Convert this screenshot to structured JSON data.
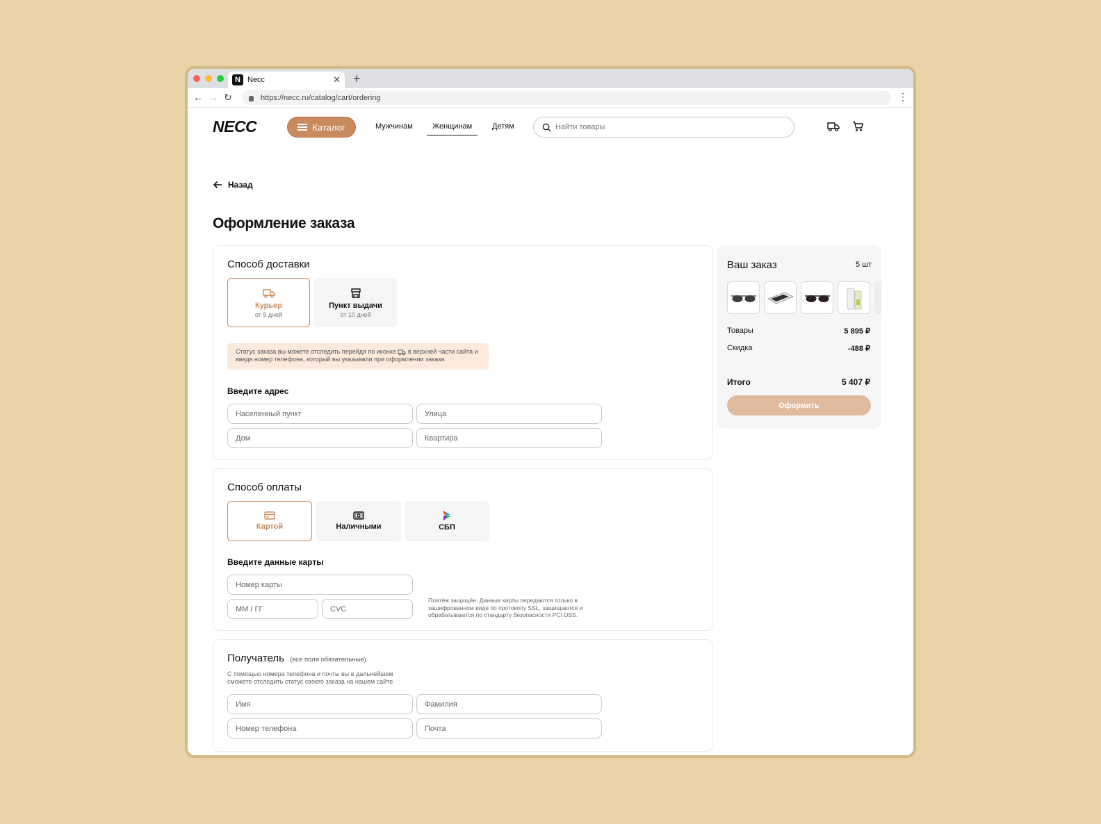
{
  "browser": {
    "tab_title": "Necc",
    "tab_favicon": "N",
    "url": "https://necc.ru/catalog/cart/ordering"
  },
  "header": {
    "logo": "NECC",
    "catalog": "Каталог",
    "nav": [
      "Мужчинам",
      "Женщинам",
      "Детям"
    ],
    "search_placeholder": "Найти товары"
  },
  "page": {
    "back": "Назад",
    "title": "Оформление заказа"
  },
  "delivery": {
    "title": "Способ доставки",
    "options": [
      {
        "label": "Курьер",
        "sub": "от 5 дней",
        "icon": "truck-icon"
      },
      {
        "label": "Пункт выдачи",
        "sub": "от 10 дней",
        "icon": "store-icon"
      }
    ],
    "notice_before": "Статус заказа вы можете отследить перейдя по иконке",
    "notice_after": "в верхней части сайта и введя номер телефона, который вы указывали при оформлении заказа",
    "address_label": "Введите адрес",
    "fields": [
      "Населенный пункт",
      "Улица",
      "Дом",
      "Квартира"
    ]
  },
  "payment": {
    "title": "Способ оплаты",
    "options": [
      {
        "label": "Картой",
        "icon": "card-icon"
      },
      {
        "label": "Наличными",
        "icon": "cash-icon"
      },
      {
        "label": "СБП",
        "icon": "sbp-icon"
      }
    ],
    "card_label": "Введите данные карты",
    "fields": [
      "Номер карты",
      "ММ / ГГ",
      "CVC"
    ],
    "secure_note": "Платёж защищён. Данные карты передаются только в зашифрованном виде по протоколу SSL, защищаются и обрабатываются по стандарту безопасности PCI DSS."
  },
  "recipient": {
    "title": "Получатель",
    "title_note": "(все поля обязательные)",
    "hint": "С помощью номера телефона и почты вы в дальнейшем сможете отследить статус своего заказа на нашем сайте",
    "fields": [
      "Имя",
      "Фамилия",
      "Номер телефона",
      "Почта"
    ]
  },
  "summary": {
    "title": "Ваш заказ",
    "count": "5 шт",
    "products": [
      "sunglasses",
      "sunglasses-case",
      "sunglasses",
      "lens-care-kit"
    ],
    "rows": [
      {
        "label": "Товары",
        "value": "5 895 ₽"
      },
      {
        "label": "Скидка",
        "value": "-488 ₽"
      }
    ],
    "total_label": "Итого",
    "total_value": "5 407 ₽",
    "checkout": "Оформить"
  },
  "colors": {
    "accent": "#c98a5e",
    "accent_light": "#e1bba0",
    "notice_bg": "#fbe9dc",
    "page_bg": "#e8d4a6"
  }
}
